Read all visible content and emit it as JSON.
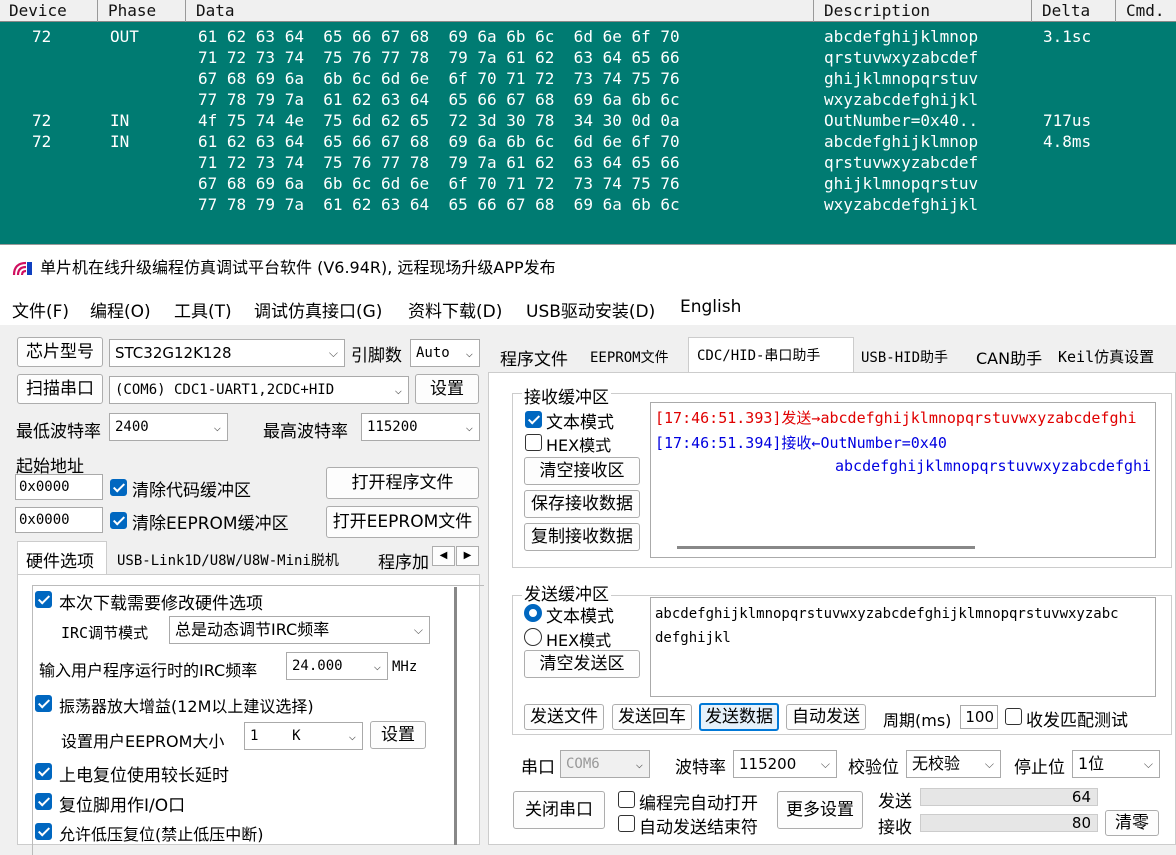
{
  "analyzer": {
    "columns": [
      "Device",
      "Phase",
      "Data",
      "Description",
      "Delta",
      "Cmd."
    ],
    "rows": [
      {
        "device": "72",
        "phase": "OUT",
        "data": "61 62 63 64  65 66 67 68  69 6a 6b 6c  6d 6e 6f 70",
        "desc": "abcdefghijklmnop",
        "delta": "3.1sc"
      },
      {
        "device": "",
        "phase": "",
        "data": "71 72 73 74  75 76 77 78  79 7a 61 62  63 64 65 66",
        "desc": "qrstuvwxyzabcdef",
        "delta": ""
      },
      {
        "device": "",
        "phase": "",
        "data": "67 68 69 6a  6b 6c 6d 6e  6f 70 71 72  73 74 75 76",
        "desc": "ghijklmnopqrstuv",
        "delta": ""
      },
      {
        "device": "",
        "phase": "",
        "data": "77 78 79 7a  61 62 63 64  65 66 67 68  69 6a 6b 6c",
        "desc": "wxyzabcdefghijkl",
        "delta": ""
      },
      {
        "device": "72",
        "phase": "IN",
        "data": "4f 75 74 4e  75 6d 62 65  72 3d 30 78  34 30 0d 0a",
        "desc": "OutNumber=0x40..",
        "delta": "717us"
      },
      {
        "device": "72",
        "phase": "IN",
        "data": "61 62 63 64  65 66 67 68  69 6a 6b 6c  6d 6e 6f 70",
        "desc": "abcdefghijklmnop",
        "delta": "4.8ms"
      },
      {
        "device": "",
        "phase": "",
        "data": "71 72 73 74  75 76 77 78  79 7a 61 62  63 64 65 66",
        "desc": "qrstuvwxyzabcdef",
        "delta": ""
      },
      {
        "device": "",
        "phase": "",
        "data": "67 68 69 6a  6b 6c 6d 6e  6f 70 71 72  73 74 75 76",
        "desc": "ghijklmnopqrstuv",
        "delta": ""
      },
      {
        "device": "",
        "phase": "",
        "data": "77 78 79 7a  61 62 63 64  65 66 67 68  69 6a 6b 6c",
        "desc": "wxyzabcdefghijkl",
        "delta": ""
      }
    ]
  },
  "window": {
    "title": "单片机在线升级编程仿真调试平台软件 (V6.94R), 远程现场升级APP发布",
    "menu": [
      "文件(F)",
      "编程(O)",
      "工具(T)",
      "调试仿真接口(G)",
      "资料下载(D)",
      "USB驱动安装(D)",
      "English"
    ]
  },
  "left": {
    "chip_label": "芯片型号",
    "chip_value": "STC32G12K128",
    "pins_label": "引脚数",
    "pins_value": "Auto",
    "scan_label": "扫描串口",
    "port_value": "(COM6) CDC1-UART1,2CDC+HID",
    "settings_button": "设置",
    "min_baud_label": "最低波特率",
    "min_baud_value": "2400",
    "max_baud_label": "最高波特率",
    "max_baud_value": "115200",
    "start_addr_label": "起始地址",
    "code_addr": "0x0000",
    "clear_code_label": "清除代码缓冲区",
    "open_prog_button": "打开程序文件",
    "eeprom_addr": "0x0000",
    "clear_eeprom_label": "清除EEPROM缓冲区",
    "open_eeprom_button": "打开EEPROM文件",
    "tabs": [
      "硬件选项",
      "USB-Link1D/U8W/U8W-Mini脱机",
      "程序加"
    ],
    "hw": {
      "modify_label": "本次下载需要修改硬件选项",
      "irc_mode_label": "IRC调节模式",
      "irc_mode_value": "总是动态调节IRC频率",
      "irc_freq_label": "输入用户程序运行时的IRC频率",
      "irc_freq_value": "24.000",
      "irc_freq_unit": "MHz",
      "osc_gain_label": "振荡器放大增益(12M以上建议选择)",
      "eeprom_size_label": "设置用户EEPROM大小",
      "eeprom_size_value": "1    K",
      "eeprom_set_button": "设置",
      "power_reset_label": "上电复位使用较长延时",
      "reset_pin_label": "复位脚用作I/O口",
      "lvd_label": "允许低压复位(禁止低压中断)"
    }
  },
  "right": {
    "tabs": [
      "程序文件",
      "EEPROM文件",
      "CDC/HID-串口助手",
      "USB-HID助手",
      "CAN助手",
      "Keil仿真设置"
    ],
    "recv": {
      "title": "接收缓冲区",
      "text_mode": "文本模式",
      "hex_mode": "HEX模式",
      "clear": "清空接收区",
      "save": "保存接收数据",
      "copy": "复制接收数据",
      "line1": "[17:46:51.393]发送→abcdefghijklmnopqrstuvwxyzabcdefghi",
      "line2": "[17:46:51.394]接收←OutNumber=0x40",
      "line3": "abcdefghijklmnopqrstuvwxyzabcdefghi",
      "send_color": "#e00000",
      "recv_color": "#0000e0"
    },
    "send": {
      "title": "发送缓冲区",
      "text_mode": "文本模式",
      "hex_mode": "HEX模式",
      "clear": "清空发送区",
      "content_line1": "abcdefghijklmnopqrstuvwxyzabcdefghijklmnopqrstuvwxyzabc",
      "content_line2": "defghijkl",
      "send_file": "发送文件",
      "send_enter": "发送回车",
      "send_data": "发送数据",
      "auto_send": "自动发送",
      "period_label": "周期(ms)",
      "period_value": "100",
      "match_test": "收发匹配测试"
    },
    "port": {
      "port_label": "串口",
      "port_value": "COM6",
      "baud_label": "波特率",
      "baud_value": "115200",
      "parity_label": "校验位",
      "parity_value": "无校验",
      "stop_label": "停止位",
      "stop_value": "1位",
      "close_button": "关闭串口",
      "auto_open_label": "编程完自动打开",
      "auto_end_label": "自动发送结束符",
      "more_button": "更多设置",
      "sent_label": "发送",
      "sent_count": "64",
      "recv_label": "接收",
      "recv_count": "80",
      "clear_count": "清零"
    }
  }
}
